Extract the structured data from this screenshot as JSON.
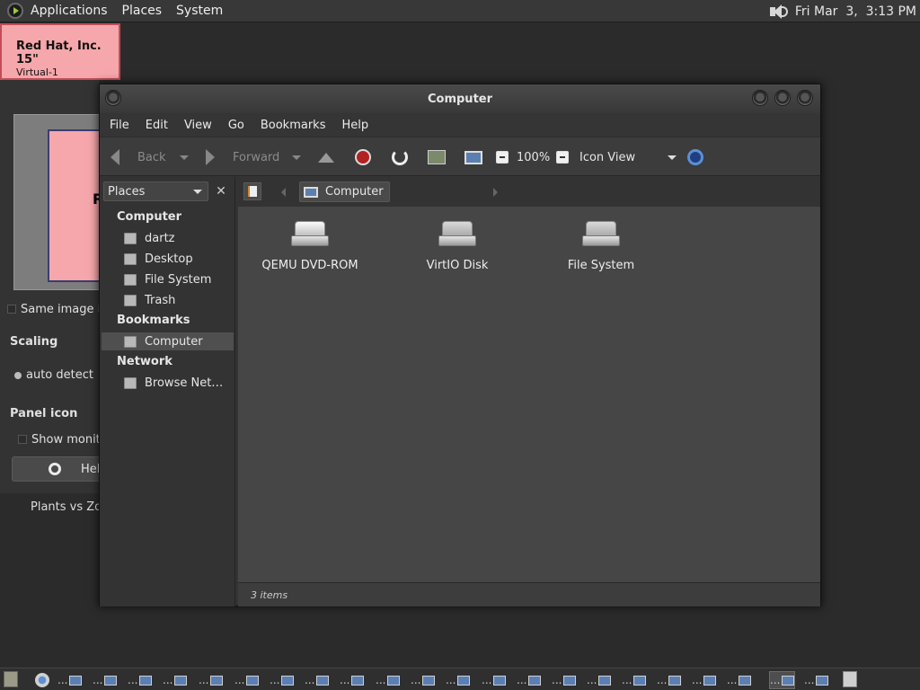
{
  "top_panel": {
    "menus": [
      "Applications",
      "Places",
      "System"
    ],
    "clock": "Fri Mar  3,  3:13 PM"
  },
  "monitor_applet": {
    "name": "Red Hat, Inc. 15\"",
    "output": "Virtual-1",
    "preview_label": "R",
    "same_image": "Same image in",
    "scaling_heading": "Scaling",
    "auto_detect": "auto detect",
    "panel_icon_heading": "Panel icon",
    "show_monitors": "Show monito",
    "help": "Help",
    "desktop_item": "Plants vs Zor"
  },
  "window": {
    "title": "Computer",
    "menu": [
      "File",
      "Edit",
      "View",
      "Go",
      "Bookmarks",
      "Help"
    ],
    "toolbar": {
      "back": "Back",
      "forward": "Forward",
      "zoom": "100%",
      "view_mode": "Icon View"
    },
    "sidebar": {
      "selector": "Places",
      "close": "✕",
      "sections": [
        {
          "heading": "Computer",
          "items": [
            "dartz",
            "Desktop",
            "File System",
            "Trash"
          ]
        },
        {
          "heading": "Bookmarks",
          "items": [
            "Computer"
          ]
        },
        {
          "heading": "Network",
          "items": [
            "Browse Net…"
          ]
        }
      ]
    },
    "location": {
      "crumb": "Computer"
    },
    "items": [
      {
        "label": "QEMU DVD-ROM",
        "icon": "optical-drive-icon"
      },
      {
        "label": "VirtIO Disk",
        "icon": "hard-disk-icon"
      },
      {
        "label": "File System",
        "icon": "hard-disk-icon"
      }
    ],
    "status": "3 items"
  },
  "taskbar": {
    "ellipsis": "..."
  }
}
